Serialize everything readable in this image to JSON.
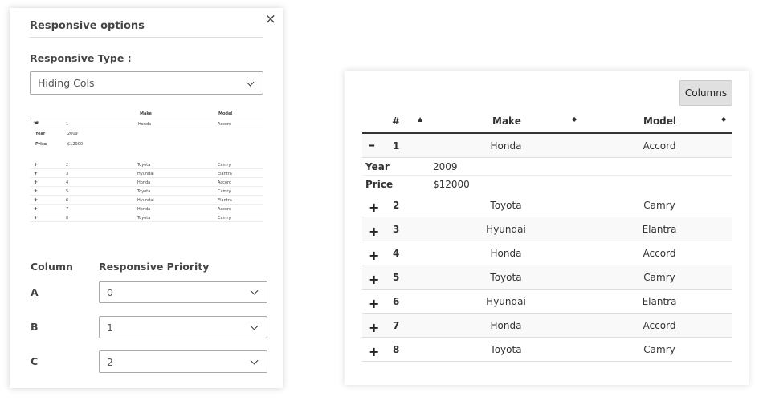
{
  "options_panel": {
    "title": "Responsive options",
    "close_icon": "×",
    "responsive_type_label": "Responsive Type :",
    "responsive_type_value": "Hiding Cols",
    "column_header": "Column",
    "priority_header": "Responsive Priority",
    "priorities": [
      {
        "column": "A",
        "value": "0"
      },
      {
        "column": "B",
        "value": "1"
      },
      {
        "column": "C",
        "value": "2"
      }
    ]
  },
  "preview": {
    "headers": {
      "make": "Make",
      "model": "Model"
    },
    "first_row": {
      "num": "1",
      "make": "Honda",
      "model": "Accord"
    },
    "child": [
      {
        "key": "Year",
        "value": "2009"
      },
      {
        "key": "Price",
        "value": "$12000"
      }
    ],
    "rows": [
      {
        "ctl": "+",
        "num": "2",
        "make": "Toyota",
        "model": "Camry"
      },
      {
        "ctl": "+",
        "num": "3",
        "make": "Hyundai",
        "model": "Elantra"
      },
      {
        "ctl": "+",
        "num": "4",
        "make": "Honda",
        "model": "Accord"
      },
      {
        "ctl": "+",
        "num": "5",
        "make": "Toyota",
        "model": "Camry"
      },
      {
        "ctl": "+",
        "num": "6",
        "make": "Hyundai",
        "model": "Elantra"
      },
      {
        "ctl": "+",
        "num": "7",
        "make": "Honda",
        "model": "Accord"
      },
      {
        "ctl": "+",
        "num": "8",
        "make": "Toyota",
        "model": "Camry"
      }
    ]
  },
  "table": {
    "columns_button": "Columns",
    "headers": {
      "num": "#",
      "make": "Make",
      "model": "Model"
    },
    "sort_icons": {
      "num": "▲",
      "make": "◆",
      "model": "◆"
    },
    "first_row": {
      "ctl": "–",
      "num": "1",
      "make": "Honda",
      "model": "Accord"
    },
    "child": [
      {
        "key": "Year",
        "value": "2009"
      },
      {
        "key": "Price",
        "value": "$12000"
      }
    ],
    "rows": [
      {
        "ctl": "+",
        "num": "2",
        "make": "Toyota",
        "model": "Camry"
      },
      {
        "ctl": "+",
        "num": "3",
        "make": "Hyundai",
        "model": "Elantra"
      },
      {
        "ctl": "+",
        "num": "4",
        "make": "Honda",
        "model": "Accord"
      },
      {
        "ctl": "+",
        "num": "5",
        "make": "Toyota",
        "model": "Camry"
      },
      {
        "ctl": "+",
        "num": "6",
        "make": "Hyundai",
        "model": "Elantra"
      },
      {
        "ctl": "+",
        "num": "7",
        "make": "Honda",
        "model": "Accord"
      },
      {
        "ctl": "+",
        "num": "8",
        "make": "Toyota",
        "model": "Camry"
      }
    ]
  }
}
